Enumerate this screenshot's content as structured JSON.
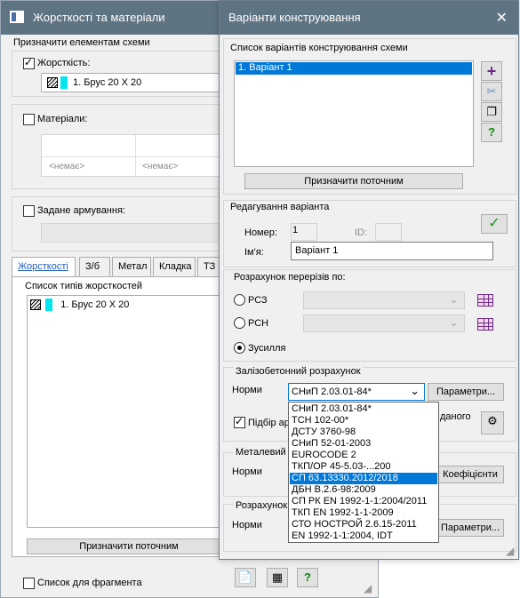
{
  "back_window": {
    "title": "Жорсткості та матеріали",
    "assign_group_title": "Призначити елементам схеми",
    "stiffness_label": "Жорсткість:",
    "stiffness_value": "1. Брус 20 Х 20",
    "materials_label": "Матеріали:",
    "materials_none_1": "<немає>",
    "materials_none_2": "<немає>",
    "reinforcement_label": "Задане армування:",
    "tabs": [
      "Жорсткості",
      "З/б",
      "Метал",
      "Кладка",
      "ТЗ"
    ],
    "list_title": "Список типів жорсткостей",
    "list_items": [
      "1. Брус 20 Х 20"
    ],
    "assign_current_button": "Призначити поточним",
    "fragment_checkbox_label": "Список для фрагмента"
  },
  "front_window": {
    "title": "Варіанти конструювання",
    "variants_group_title": "Список варіантів конструювання схеми",
    "variants": [
      "1. Варіант 1"
    ],
    "assign_current_button": "Призначити поточним",
    "edit_group_title": "Редагування варіанта",
    "number_label": "Номер:",
    "number_value": "1",
    "id_label": "ID:",
    "name_label": "Ім'я:",
    "name_value": "Варіант 1",
    "sections_group_title": "Розрахунок перерізів по:",
    "radio_rsz": "РСЗ",
    "radio_rsn": "РСН",
    "radio_forces": "Зусилля",
    "rc_group_title": "Залізобетонний розрахунок",
    "norms_label": "Норми",
    "norms_selected": "СНиП 2.03.01-84*",
    "params_button": "Параметри...",
    "selection_checkbox_label": "Підбір ар",
    "selection_suffix": "даного",
    "metal_group_title": "Металевий",
    "metal_norms_label": "Норми",
    "coeff_button": "Коефіцієнти",
    "calc_group_title": "Розрахунок",
    "calc_norms_label": "Норми",
    "params_button_2": "Параметри..."
  },
  "norms_dropdown": {
    "selected_index": 7,
    "options": [
      "СНиП 2.03.01-84*",
      "ТСН 102-00*",
      "ДСТУ 3760-98",
      "СНиП 52-01-2003",
      "EUROCODE 2",
      "ТКП/ОР 45-5.03-...200",
      "СП 63.13330.2012/2018",
      "ДБН В.2.6-98:2009",
      "СП РК EN 1992-1-1:2004/2011",
      "ТКП EN 1992-1-1-2009",
      "СТО НОСТРОЙ 2.6.15-2011",
      "EN 1992-1-1:2004, IDT"
    ]
  },
  "colors": {
    "titlebar": "#5f7483",
    "selection": "#0078d7",
    "cyan_marker": "#00e5ee"
  }
}
